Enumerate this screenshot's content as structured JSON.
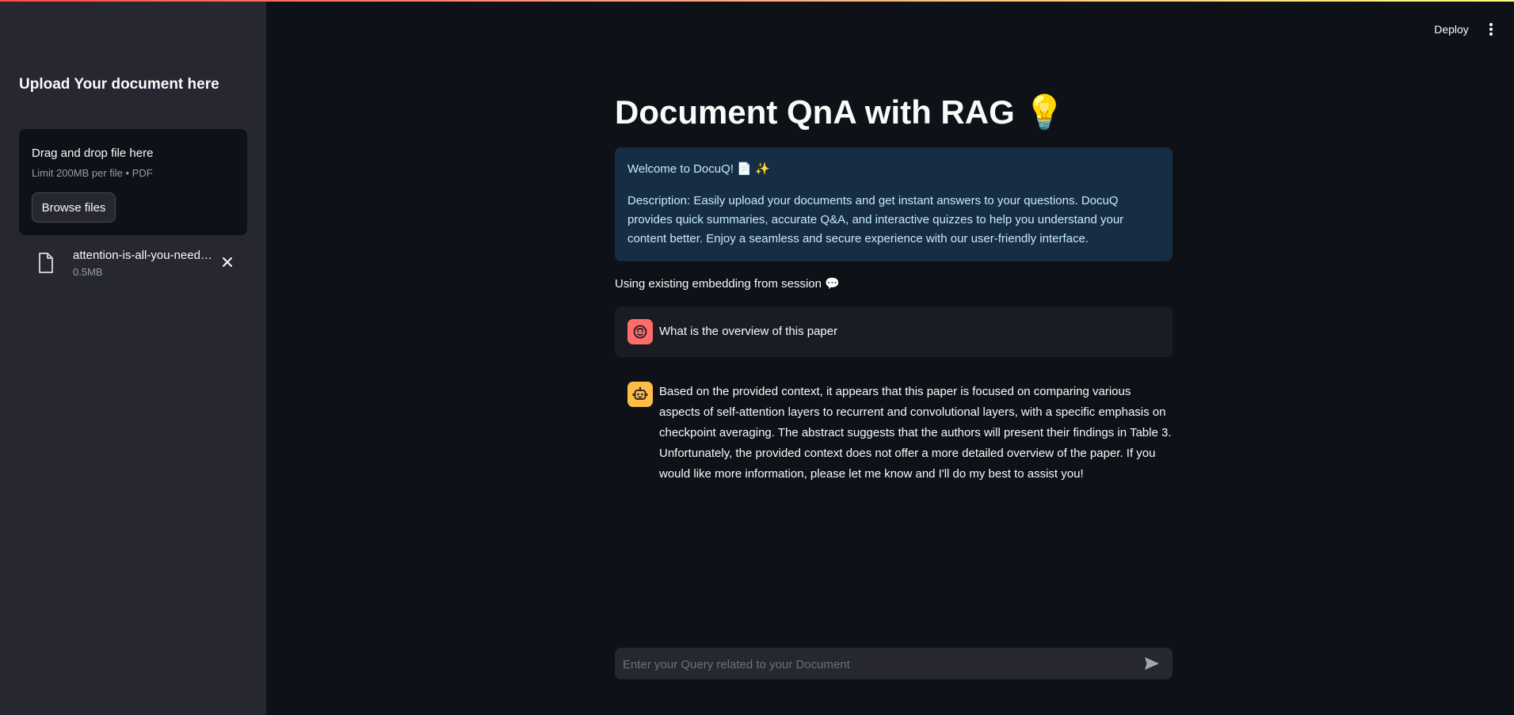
{
  "header": {
    "deploy_label": "Deploy",
    "menu_icon": "vertical-dots-icon"
  },
  "sidebar": {
    "title": "Upload Your document here",
    "uploader": {
      "drop_text": "Drag and drop file here",
      "limit_text": "Limit 200MB per file • PDF",
      "browse_label": "Browse files"
    },
    "uploaded_file": {
      "name": "attention-is-all-you-need…",
      "size": "0.5MB"
    }
  },
  "main": {
    "title": "Document QnA with RAG 💡",
    "info": {
      "welcome": "Welcome to DocuQ! 📄 ✨",
      "description": "Description: Easily upload your documents and get instant answers to your questions. DocuQ provides quick summaries, accurate Q&A, and interactive quizzes to help you understand your content better. Enjoy a seamless and secure experience with our user-friendly interface."
    },
    "session_note": "Using existing embedding from session 💬",
    "messages": [
      {
        "role": "user",
        "text": "What is the overview of this paper"
      },
      {
        "role": "assistant",
        "text": "Based on the provided context, it appears that this paper is focused on comparing various aspects of self-attention layers to recurrent and convolutional layers, with a specific emphasis on checkpoint averaging. The abstract suggests that the authors will present their findings in Table 3. Unfortunately, the provided context does not offer a more detailed overview of the paper. If you would like more information, please let me know and I'll do my best to assist you!"
      }
    ],
    "chat_input": {
      "placeholder": "Enter your Query related to your Document",
      "value": ""
    }
  },
  "colors": {
    "background": "#0e1117",
    "sidebar": "#262730",
    "info_box": "#172d43",
    "info_text": "#c7ebff",
    "user_avatar": "#ff6c6c",
    "assistant_avatar": "#ffbd45"
  }
}
